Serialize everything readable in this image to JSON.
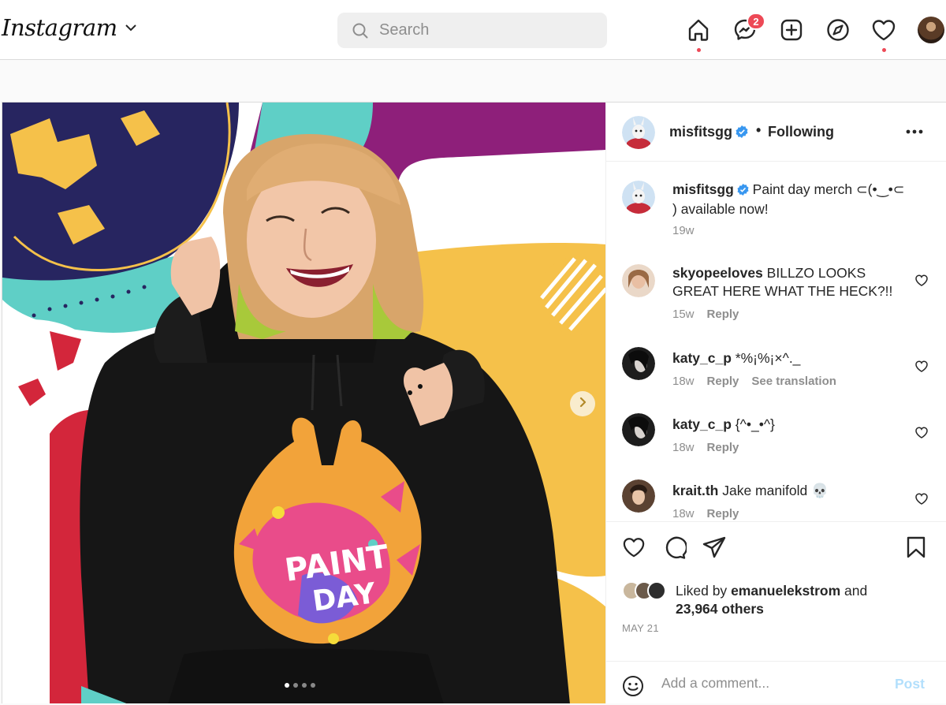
{
  "nav": {
    "logo": "Instagram",
    "search_placeholder": "Search",
    "messenger_badge": "2",
    "icons": [
      "home-icon",
      "messenger-icon",
      "new-post-icon",
      "explore-icon",
      "activity-heart-icon",
      "profile-avatar"
    ]
  },
  "post": {
    "media": {
      "carousel_total": 4,
      "carousel_active": 1,
      "shirt_text": [
        "PAINT",
        "DAY"
      ]
    },
    "header": {
      "username": "misfitsgg",
      "separator": "•",
      "follow_status": "Following"
    },
    "caption": {
      "username": "misfitsgg",
      "text": "Paint day merch ⊂(•‿•⊂ ) available now!",
      "time": "19w"
    },
    "comments": [
      {
        "username": "skyopeeloves",
        "text": "BILLZO LOOKS GREAT HERE WHAT THE HECK?!!",
        "time": "15w",
        "reply": "Reply",
        "translate": ""
      },
      {
        "username": "katy_c_p",
        "text": "*%¡%¡×^._",
        "time": "18w",
        "reply": "Reply",
        "translate": "See translation"
      },
      {
        "username": "katy_c_p",
        "text": "{^•_•^}",
        "time": "18w",
        "reply": "Reply",
        "translate": ""
      },
      {
        "username": "krait.th",
        "text": "Jake manifold 💀",
        "time": "18w",
        "reply": "Reply",
        "translate": ""
      }
    ],
    "likes": {
      "prefix": "Liked by",
      "user": "emanuelekstrom",
      "joiner": "and",
      "others": "23,964 others"
    },
    "date": "MAY 21",
    "add_comment": {
      "placeholder": "Add a comment...",
      "post_label": "Post"
    }
  },
  "colors": {
    "accent_red": "#ed4956",
    "link_blue": "#0095f6",
    "post_disabled": "#b2dffc",
    "verified": "#3897f0"
  }
}
